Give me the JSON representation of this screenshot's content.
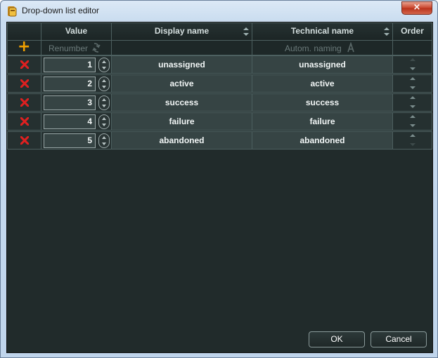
{
  "window": {
    "title": "Drop-down list editor",
    "close_glyph": "×"
  },
  "table": {
    "columns": {
      "value": "Value",
      "display_name": "Display name",
      "technical_name": "Technical name",
      "order": "Order"
    },
    "toolbar": {
      "add_glyph": "+",
      "renumber_label": "Renumber",
      "autonaming_label": "Autom. naming"
    },
    "rows": [
      {
        "value": "1",
        "display_name": "unassigned",
        "technical_name": "unassigned"
      },
      {
        "value": "2",
        "display_name": "active",
        "technical_name": "active"
      },
      {
        "value": "3",
        "display_name": "success",
        "technical_name": "success"
      },
      {
        "value": "4",
        "display_name": "failure",
        "technical_name": "failure"
      },
      {
        "value": "5",
        "display_name": "abandoned",
        "technical_name": "abandoned"
      }
    ]
  },
  "buttons": {
    "ok": "OK",
    "cancel": "Cancel"
  },
  "colors": {
    "background": "#212b2b",
    "cell_fill": "#364444",
    "delete_red": "#e02020",
    "add_orange": "#f0a000"
  },
  "icons": {
    "app": "app-icon",
    "add": "add-row-icon",
    "delete": "delete-x-icon",
    "sort": "sort-arrows-icon",
    "renumber": "renumber-icon",
    "autonaming": "autonaming-icon",
    "spinner": "spinner-arrows-icon",
    "order": "order-up-down-icon"
  }
}
